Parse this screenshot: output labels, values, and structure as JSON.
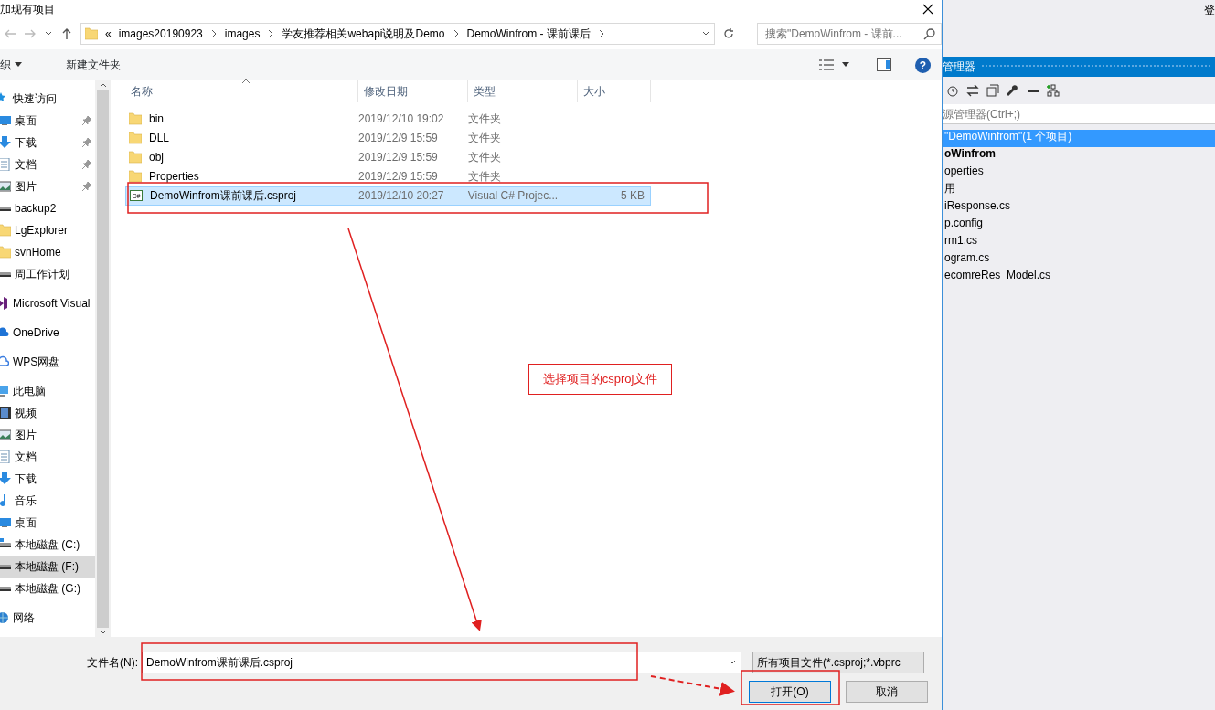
{
  "dialog": {
    "title": "加现有项目",
    "address": {
      "prefix": "«",
      "crumbs": [
        "images20190923",
        "images",
        "学友推荐相关webapi说明及Demo",
        "DemoWinfrom - 课前课后"
      ]
    },
    "search": {
      "placeholder": "搜索\"DemoWinfrom - 课前..."
    },
    "toolbar": {
      "organize": "织",
      "new_folder": "新建文件夹",
      "help": "?"
    },
    "sidebar": {
      "items": [
        {
          "label": "快速访问",
          "kind": "star",
          "selected": false,
          "children": [
            {
              "label": "桌面",
              "kind": "desktop",
              "pinned": true,
              "selected": false
            },
            {
              "label": "下载",
              "kind": "download",
              "pinned": true,
              "selected": false
            },
            {
              "label": "文档",
              "kind": "document",
              "pinned": true,
              "selected": false
            },
            {
              "label": "图片",
              "kind": "picture",
              "pinned": true,
              "selected": false
            },
            {
              "label": "backup2",
              "kind": "drive",
              "pinned": false,
              "selected": false
            },
            {
              "label": "LgExplorer",
              "kind": "folder",
              "pinned": false,
              "selected": false
            },
            {
              "label": "svnHome",
              "kind": "folder",
              "pinned": false,
              "selected": false
            },
            {
              "label": "周工作计划",
              "kind": "drive",
              "pinned": false,
              "selected": false
            }
          ]
        },
        {
          "label": "Microsoft Visual",
          "kind": "vs",
          "selected": false
        },
        {
          "label": "OneDrive",
          "kind": "cloud",
          "selected": false
        },
        {
          "label": "WPS网盘",
          "kind": "wps",
          "selected": false
        },
        {
          "label": "此电脑",
          "kind": "pc",
          "selected": false,
          "children": [
            {
              "label": "视频",
              "kind": "video",
              "selected": false
            },
            {
              "label": "图片",
              "kind": "picture",
              "selected": false
            },
            {
              "label": "文档",
              "kind": "document",
              "selected": false
            },
            {
              "label": "下载",
              "kind": "download",
              "selected": false
            },
            {
              "label": "音乐",
              "kind": "music",
              "selected": false
            },
            {
              "label": "桌面",
              "kind": "desktop",
              "selected": false
            },
            {
              "label": "本地磁盘 (C:)",
              "kind": "system-drive",
              "selected": false
            },
            {
              "label": "本地磁盘 (F:)",
              "kind": "drive",
              "selected": true
            },
            {
              "label": "本地磁盘 (G:)",
              "kind": "drive",
              "selected": false
            }
          ]
        },
        {
          "label": "网络",
          "kind": "network",
          "selected": false
        }
      ]
    },
    "table": {
      "columns": [
        "名称",
        "修改日期",
        "类型",
        "大小"
      ],
      "rows": [
        {
          "kind": "folder",
          "name": "bin",
          "date": "2019/12/10 19:02",
          "type": "文件夹",
          "selected": false
        },
        {
          "kind": "folder",
          "name": "DLL",
          "date": "2019/12/9 15:59",
          "type": "文件夹",
          "selected": false
        },
        {
          "kind": "folder",
          "name": "obj",
          "date": "2019/12/9 15:59",
          "type": "文件夹",
          "selected": false
        },
        {
          "kind": "folder",
          "name": "Properties",
          "date": "2019/12/9 15:59",
          "type": "文件夹",
          "selected": false
        },
        {
          "kind": "csproj",
          "icon_label": "C#",
          "name": "DemoWinfrom课前课后.csproj",
          "date": "2019/12/10 20:27",
          "type": "Visual C# Projec...",
          "size": "5 KB",
          "selected": true
        }
      ]
    },
    "filename": {
      "label": "文件名(N):",
      "value": "DemoWinfrom课前课后.csproj"
    },
    "filter": "所有项目文件(*.csproj;*.vbprc",
    "buttons": [
      "打开(O)",
      "取消"
    ]
  },
  "annotation": {
    "note": "选择项目的csproj文件"
  },
  "ide": {
    "corner_text": "登",
    "panel_title": "管理器",
    "search": {
      "placeholder": "源管理器(Ctrl+;)"
    },
    "tree": [
      {
        "label": "\"DemoWinfrom\"(1 个项目)",
        "kind": "solution",
        "selected": true,
        "children": [
          {
            "label": "oWinfrom",
            "kind": "project",
            "selected": false,
            "children": [
              {
                "label": "operties",
                "kind": "item",
                "selected": false
              },
              {
                "label": "用",
                "kind": "item",
                "selected": false
              },
              {
                "label": "iResponse.cs",
                "kind": "item",
                "selected": false
              },
              {
                "label": "p.config",
                "kind": "item",
                "selected": false
              },
              {
                "label": "rm1.cs",
                "kind": "item",
                "selected": false
              },
              {
                "label": "ogram.cs",
                "kind": "item",
                "selected": false
              },
              {
                "label": "ecomreRes_Model.cs",
                "kind": "item",
                "selected": false
              }
            ]
          }
        ]
      }
    ]
  }
}
